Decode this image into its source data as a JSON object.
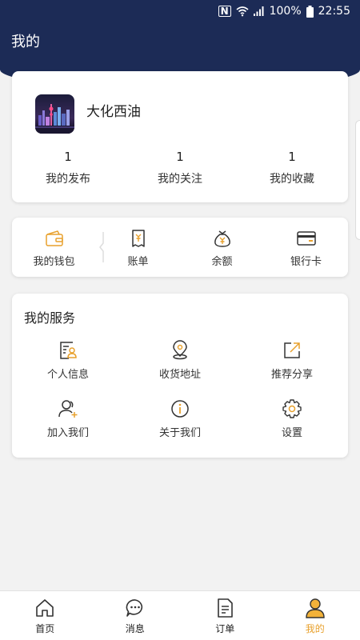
{
  "status_bar": {
    "battery": "100%",
    "time": "22:55"
  },
  "header": {
    "title": "我的"
  },
  "profile": {
    "username": "大化西油",
    "stats": [
      {
        "count": "1",
        "label": "我的发布"
      },
      {
        "count": "1",
        "label": "我的关注"
      },
      {
        "count": "1",
        "label": "我的收藏"
      }
    ]
  },
  "finance": {
    "items": [
      {
        "label": "我的钱包",
        "icon": "wallet-icon"
      },
      {
        "label": "账单",
        "icon": "bill-icon"
      },
      {
        "label": "余额",
        "icon": "money-bag-icon"
      },
      {
        "label": "银行卡",
        "icon": "bank-card-icon"
      }
    ]
  },
  "services": {
    "title": "我的服务",
    "items": [
      {
        "label": "个人信息",
        "icon": "personal-info-icon"
      },
      {
        "label": "收货地址",
        "icon": "location-icon"
      },
      {
        "label": "推荐分享",
        "icon": "share-icon"
      },
      {
        "label": "加入我们",
        "icon": "add-user-icon"
      },
      {
        "label": "关于我们",
        "icon": "info-icon"
      },
      {
        "label": "设置",
        "icon": "gear-icon"
      }
    ]
  },
  "bottom_nav": {
    "items": [
      {
        "label": "首页",
        "icon": "home-icon"
      },
      {
        "label": "消息",
        "icon": "chat-icon"
      },
      {
        "label": "订单",
        "icon": "order-icon"
      },
      {
        "label": "我的",
        "icon": "user-icon",
        "active": true
      }
    ]
  },
  "colors": {
    "header": "#1c2b56",
    "accent": "#e8a12d",
    "icon_dark": "#333333",
    "background": "#f2f2f2"
  }
}
